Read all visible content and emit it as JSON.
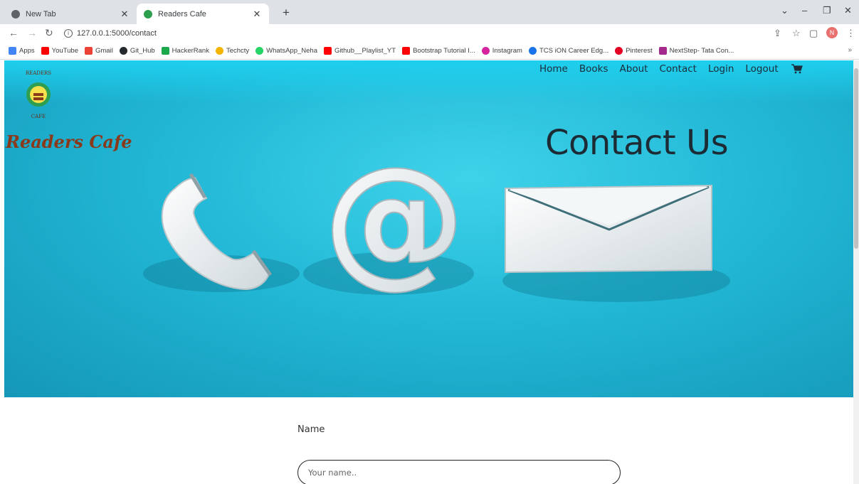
{
  "browser": {
    "tabs": [
      {
        "title": "New Tab",
        "active": false
      },
      {
        "title": "Readers Cafe",
        "active": true
      }
    ],
    "url": "127.0.0.1:5000/contact",
    "profile_initial": "N",
    "bookmarks": [
      {
        "label": "Apps",
        "color": "#4285f4"
      },
      {
        "label": "YouTube",
        "color": "#ff0000"
      },
      {
        "label": "Gmail",
        "color": "#ea4335"
      },
      {
        "label": "Git_Hub",
        "color": "#24292e"
      },
      {
        "label": "HackerRank",
        "color": "#1ba94c"
      },
      {
        "label": "Techcty",
        "color": "#f4b400"
      },
      {
        "label": "WhatsApp_Neha",
        "color": "#25d366"
      },
      {
        "label": "Github__Playlist_YT",
        "color": "#ff0000"
      },
      {
        "label": "Bootstrap Tutorial I...",
        "color": "#ff0000"
      },
      {
        "label": "Instagram",
        "color": "#d6249f"
      },
      {
        "label": "TCS iON Career Edg...",
        "color": "#1a73e8"
      },
      {
        "label": "Pinterest",
        "color": "#e60023"
      },
      {
        "label": "NextStep- Tata Con...",
        "color": "#a52a8e"
      }
    ]
  },
  "site": {
    "brand": "Readers Cafe",
    "nav": [
      "Home",
      "Books",
      "About",
      "Contact",
      "Login",
      "Logout"
    ],
    "hero_title": "Contact Us"
  },
  "form": {
    "name_label": "Name",
    "name_placeholder": "Your name.."
  },
  "colors": {
    "hero_bg": "#22b8d6",
    "brand_text": "#8a3a1a",
    "nav_text": "#1c2b3a"
  }
}
